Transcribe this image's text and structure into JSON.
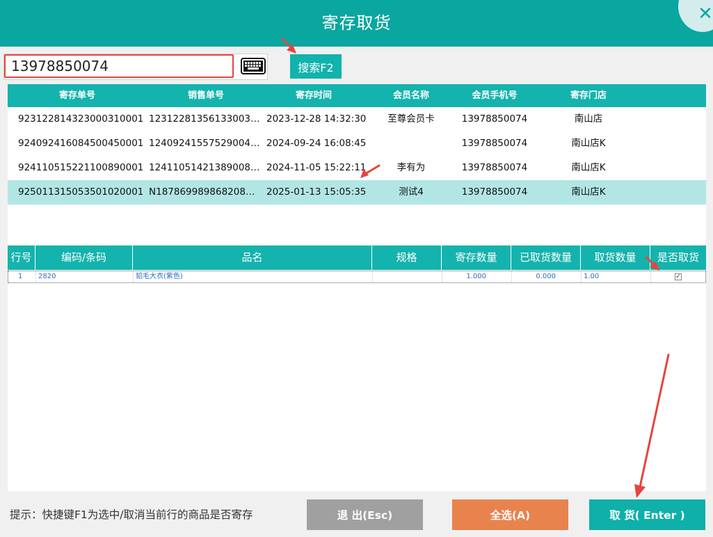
{
  "window": {
    "title": "寄存取货",
    "close_glyph": "✕"
  },
  "search": {
    "value": "13978850074",
    "keyboard_icon": "keyboard-icon",
    "button_label": "搜索F2"
  },
  "deposit_table": {
    "columns": [
      "寄存单号",
      "销售单号",
      "寄存时间",
      "会员名称",
      "会员手机号",
      "寄存门店"
    ],
    "rows": [
      [
        "923122814323000310001",
        "123122813561330031...",
        "2023-12-28 14:32:30",
        "至尊会员卡",
        "13978850074",
        "南山店"
      ],
      [
        "924092416084500450001",
        "124092415575290045...",
        "2024-09-24 16:08:45",
        "",
        "13978850074",
        "南山店K"
      ],
      [
        "924110515221100890001",
        "124110514213890089...",
        "2024-11-05 15:22:11",
        "李有为",
        "13978850074",
        "南山店K"
      ],
      [
        "925011315053501020001",
        "N18786998986820853...",
        "2025-01-13 15:05:35",
        "测试4",
        "13978850074",
        "南山店K"
      ]
    ],
    "selected_row": 3
  },
  "goods_table": {
    "columns": [
      "行号",
      "编码/条码",
      "品名",
      "规格",
      "寄存数量",
      "已取货数量",
      "取货数量",
      "是否取货"
    ],
    "rows": [
      {
        "line": "1",
        "code": "2820",
        "name": "貂毛大衣(紫色)",
        "spec": "",
        "deposit_qty": "1.000",
        "taken_qty": "0.000",
        "pick_qty": "1.00",
        "checked_mark": "✓"
      }
    ]
  },
  "footer": {
    "hint": "提示：快捷键F1为选中/取消当前行的商品是否寄存",
    "exit_label": "退 出(Esc)",
    "select_all_label": "全选(A)",
    "take_label": "取 货( Enter )"
  },
  "colors": {
    "teal": "#0aa6a0",
    "header_teal": "#14b3ad",
    "selected_row": "#b2e6e4",
    "orange": "#e8834d",
    "gray": "#a0a0a0",
    "annotation_red": "#e6453d"
  }
}
